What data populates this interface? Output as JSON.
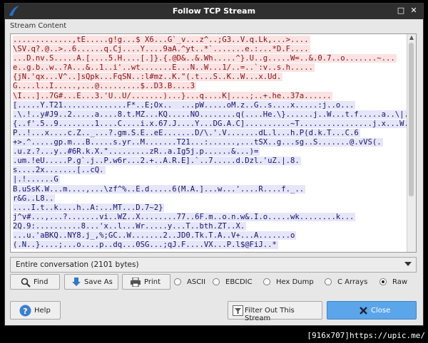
{
  "window": {
    "title": "Follow TCP Stream"
  },
  "stream": {
    "label": "Stream Content",
    "lines": [
      {
        "t": ".............,tE.....g!g...$ X6...G`_v...z^..;G3..V.q.Lk,...>....",
        "k": "c"
      },
      {
        "t": "\\SV.q?.@..>..6......q.Cj....Y....9aA.^yt..*`.......e.:...*D.F....",
        "k": "c"
      },
      {
        "t": "...D.nv.S.....A.[....5.H....[.]}.{.@D&..&.Wh.....^}.U..g.....W=..&.0.7..o.......~...",
        "k": "c"
      },
      {
        "t": "e..g.b..w..?A...&..1..i'..wt.......E...N..W...1/..=..`:v..s.h.....",
        "k": "c"
      },
      {
        "t": "{jN.'qx...V^..]sQpk...FqSN..:l#mz..K.\"(.t...S..K..W...x.Ud.",
        "k": "c"
      },
      {
        "t": "G....l..I.....,...@.........$..D3.B....3",
        "k": "c"
      },
      {
        "t": "\\I...]..7G#...E...3.'U..U/.......)...}...q....K|....;..+.he..37a......",
        "k": "c"
      },
      {
        "t": "[.....Y.T21..............F*..E;Ox..  ...pW.....oM.z..G..s....x.....:j..o...",
        "k": "s"
      },
      {
        "t": ".\\.!..y#J9..2.....a....8.t.MZ...KQ.....NO........q(....He.\\}......j..W...t.f.....a..\\|......",
        "k": "s"
      },
      {
        "t": "{..f'.5..9........1....C....i.x.67.J....Y...DG.A.C]..........~T................j.x...W.U}.",
        "k": "s"
      },
      {
        "t": "P..!...x....c.Z.._...?.gm.S.E..eE.......D/\\.'.V.......dL.l...h.P(d.k.T...C.6",
        "k": "s"
      },
      {
        "t": "+>.^.....gp.m...B.....s.yr..M.......T21...:......,...tSX..g...sg..S.......@.vVS(.",
        "k": "s"
      },
      {
        "t": ".u.z.?...y..#6R.k.X.\".........zR..a.Ig5j.p......&...)=",
        "k": "s"
      },
      {
        "t": ".um.!eU.....P.g`.j..P.w6r...2.+..A.R.E].`..7.....d.Dzl.'uZ.|.8.",
        "k": "s"
      },
      {
        "t": "s....2x.......[..cQ.",
        "k": "s"
      },
      {
        "t": "|.!......G",
        "k": "s"
      },
      {
        "t": "B.uSsK.W...m....,...\\zf^%..E.d.....6(M.A.]...w...'....R....f._..",
        "k": "s"
      },
      {
        "t": "r&G..L8..",
        "k": "s"
      },
      {
        "t": "....I.t..k....h..A:...MT...D.7~2}",
        "k": "s"
      },
      {
        "t": "j^v#...,...?.......vi..WZ..X........77..6F.m..o.n.w&.I.o.....wk........k...",
        "k": "s"
      },
      {
        "t": "2Q.9:..........8...'x..l...Wr.....y...T..bth.ZT..X.",
        "k": "s"
      },
      {
        "t": "...u.'aBKQ..NY8.j_,%;GC..W.......2..JD0.Tk.T.A..V+...A.......o",
        "k": "s"
      },
      {
        "t": "(.N..}....;...o....p..dq...0SG...;qJ.F....VX...P.l$@FiJ..*",
        "k": "s"
      }
    ]
  },
  "conversation": {
    "selected": "Entire conversation (2101 bytes)"
  },
  "buttons": {
    "find": "Find",
    "save_as": "Save As",
    "print": "Print",
    "help": "Help",
    "filter": "Filter Out This Stream",
    "close": "Close"
  },
  "formats": {
    "options": [
      "ASCII",
      "EBCDIC",
      "Hex Dump",
      "C Arrays",
      "Raw"
    ],
    "selected": "Raw"
  },
  "colors": {
    "client": "#8a1010",
    "server": "#14146e",
    "accent": "#5ba6ea"
  },
  "overlay": {
    "text": "[916x707]https://upic.me/"
  }
}
